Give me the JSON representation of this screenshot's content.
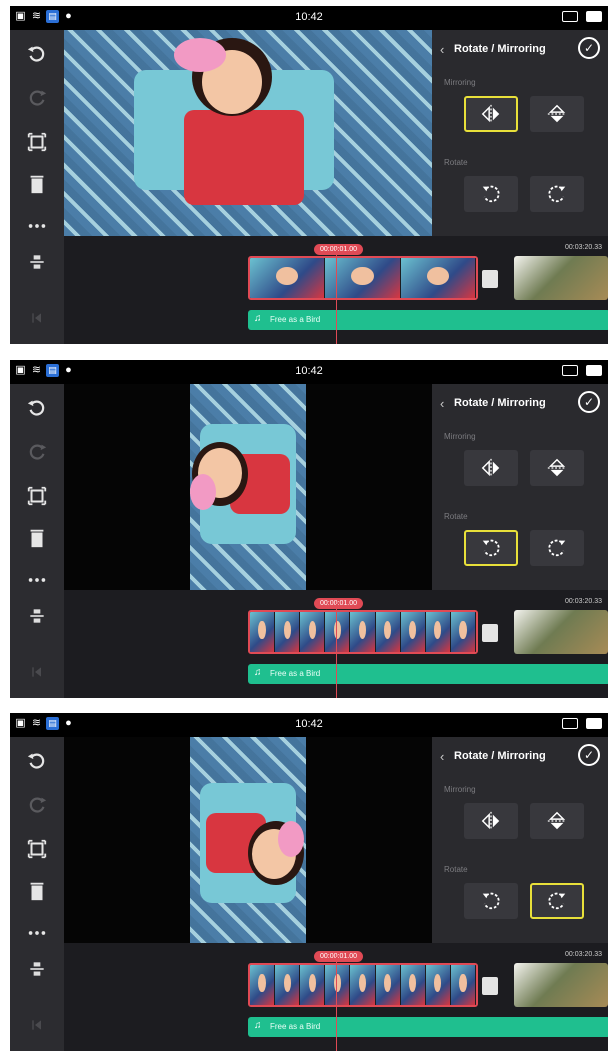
{
  "status_bar": {
    "time": "10:42"
  },
  "panel": {
    "title": "Rotate / Mirroring",
    "mirroring_label": "Mirroring",
    "rotate_label": "Rotate"
  },
  "screens": [
    {
      "playhead_time": "00:00:01.00",
      "total_time": "00:03:20.33",
      "selected_button": "mirror-horizontal",
      "audio_label": "Free as a Bird"
    },
    {
      "playhead_time": "00:00:01.00",
      "total_time": "00:03:20.33",
      "selected_button": "rotate-counterclockwise",
      "audio_label": "Free as a Bird"
    },
    {
      "playhead_time": "00:00:01.00",
      "total_time": "00:03:20.33",
      "selected_button": "rotate-clockwise",
      "audio_label": "Free as a Bird"
    }
  ],
  "icons": [
    "undo-icon",
    "redo-icon",
    "crop-icon",
    "trash-icon",
    "more-icon",
    "split-icon",
    "mirror-horizontal-icon",
    "mirror-vertical-icon",
    "rotate-ccw-icon",
    "rotate-cw-icon",
    "check-icon",
    "music-note-icon"
  ],
  "colors": {
    "selection": "#e8e03a",
    "playhead": "#e04a55",
    "audio_track": "#1fbf8f"
  }
}
